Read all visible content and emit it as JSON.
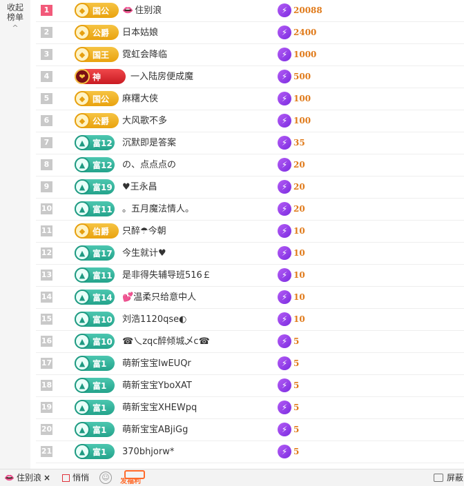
{
  "sidebar": {
    "collapse_line1": "收起",
    "collapse_line2": "榜单",
    "collapse_arrow": "^"
  },
  "rows": [
    {
      "rank": "1",
      "tier": "noble",
      "badge": "国公",
      "name": "住别浪",
      "amount": "20088",
      "lips": true
    },
    {
      "rank": "2",
      "tier": "noble",
      "badge": "公爵",
      "name": "日本姑娘",
      "amount": "2400"
    },
    {
      "rank": "3",
      "tier": "noble",
      "badge": "国王",
      "name": "霓虹会降临",
      "amount": "1000"
    },
    {
      "rank": "4",
      "tier": "god",
      "badge": "神",
      "name": "一入陆房便成魔",
      "amount": "500"
    },
    {
      "rank": "5",
      "tier": "noble",
      "badge": "国公",
      "name": "麻糬大侠",
      "amount": "100"
    },
    {
      "rank": "6",
      "tier": "noble",
      "badge": "公爵",
      "name": "大风歌不多",
      "amount": "100"
    },
    {
      "rank": "7",
      "tier": "fortune",
      "badge": "富12",
      "name": "沉默即是答案",
      "amount": "35"
    },
    {
      "rank": "8",
      "tier": "fortune",
      "badge": "富12",
      "name": "の、点点点の",
      "amount": "20"
    },
    {
      "rank": "9",
      "tier": "fortune",
      "badge": "富19",
      "name": "♥王永昌",
      "amount": "20"
    },
    {
      "rank": "10",
      "tier": "fortune",
      "badge": "富11",
      "name": "。五月魔法情人。",
      "amount": "20"
    },
    {
      "rank": "11",
      "tier": "noble",
      "badge": "伯爵",
      "name": "只醉☂今朝",
      "amount": "10"
    },
    {
      "rank": "12",
      "tier": "fortune",
      "badge": "富17",
      "name": "今生就计♥",
      "amount": "10"
    },
    {
      "rank": "13",
      "tier": "fortune",
      "badge": "富11",
      "name": "是非得失辅导班516￡",
      "amount": "10"
    },
    {
      "rank": "14",
      "tier": "fortune",
      "badge": "富14",
      "name": "💕温柔只给意中人",
      "amount": "10"
    },
    {
      "rank": "15",
      "tier": "fortune",
      "badge": "富10",
      "name": "刘浩1120qse◐",
      "amount": "10"
    },
    {
      "rank": "16",
      "tier": "fortune",
      "badge": "富10",
      "name": "☎乀zqc醉倾城乄c☎",
      "amount": "5"
    },
    {
      "rank": "17",
      "tier": "fortune",
      "badge": "富1",
      "name": "萌新宝宝IwEUQr",
      "amount": "5"
    },
    {
      "rank": "18",
      "tier": "fortune",
      "badge": "富1",
      "name": "萌新宝宝YboXAT",
      "amount": "5"
    },
    {
      "rank": "19",
      "tier": "fortune",
      "badge": "富1",
      "name": "萌新宝宝XHEWpq",
      "amount": "5"
    },
    {
      "rank": "20",
      "tier": "fortune",
      "badge": "富1",
      "name": "萌新宝宝ABjiGg",
      "amount": "5"
    },
    {
      "rank": "21",
      "tier": "fortune",
      "badge": "富1",
      "name": "370bhjorw*",
      "amount": "5"
    }
  ],
  "bottom_bar": {
    "recipient": "住别浪",
    "close": "×",
    "whisper": "悄悄",
    "gift_label": "发福利",
    "screen": "屏蔽"
  },
  "colors": {
    "noble_badge": "#e9a20e",
    "fortune_badge": "#23a38b",
    "god_badge": "#c91b22",
    "amount": "#e07a1a",
    "gift_icon": "#7b2ce0",
    "rank1": "#f25a7a"
  },
  "icons": {
    "gift": "lightning-gift-icon",
    "emoji": "smiley-icon",
    "screen": "screen-icon",
    "lips": "lips-icon"
  }
}
